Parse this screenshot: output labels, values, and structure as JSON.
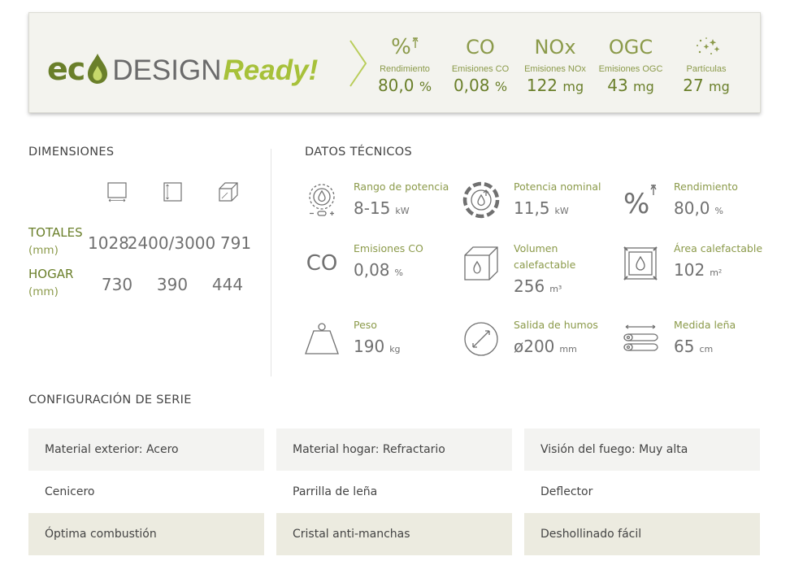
{
  "banner": {
    "logo": {
      "eco": "ec",
      "design": "DESIGN",
      "ready": "Ready!"
    },
    "metrics": [
      {
        "symbol": "%",
        "label": "Rendimiento",
        "value": "80,0",
        "unit": "%"
      },
      {
        "symbol": "CO",
        "label": "Emisiones CO",
        "value": "0,08",
        "unit": "%"
      },
      {
        "symbol": "NOx",
        "label": "Emisiones NOx",
        "value": "122",
        "unit": "mg"
      },
      {
        "symbol": "OGC",
        "label": "Emisiones OGC",
        "value": "43",
        "unit": "mg"
      },
      {
        "symbol": "",
        "label": "Partículas",
        "value": "27",
        "unit": "mg"
      }
    ],
    "colors": {
      "accent": "#a7c13a",
      "dark_green": "#6a7f2a",
      "olive": "#8b9a4a"
    }
  },
  "dimensions": {
    "title": "DIMENSIONES",
    "rows": [
      {
        "label": "TOTALES",
        "unit": "(mm)",
        "values": [
          "1028",
          "2400/3000",
          "791"
        ]
      },
      {
        "label": "HOGAR",
        "unit": "(mm)",
        "values": [
          "730",
          "390",
          "444"
        ]
      }
    ]
  },
  "tech": {
    "title": "DATOS TÉCNICOS",
    "items": [
      {
        "icon": "power-range-icon",
        "label": "Rango de potencia",
        "value": "8-15",
        "unit": "kW"
      },
      {
        "icon": "nominal-power-icon",
        "label": "Potencia nominal",
        "value": "11,5",
        "unit": "kW"
      },
      {
        "icon": "efficiency-icon",
        "label": "Rendimiento",
        "value": "80,0",
        "unit": "%"
      },
      {
        "icon": "co-emissions-icon",
        "icon_text": "CO",
        "label": "Emisiones CO",
        "value": "0,08",
        "unit": "%"
      },
      {
        "icon": "heated-volume-icon",
        "label": "Volumen calefactable",
        "label_line1": "Volumen",
        "label_line2": "calefactable",
        "value": "256",
        "unit": "m³"
      },
      {
        "icon": "heated-area-icon",
        "label": "Área calefactable",
        "value": "102",
        "unit": "m²"
      },
      {
        "icon": "weight-icon",
        "label": "Peso",
        "value": "190",
        "unit": "kg"
      },
      {
        "icon": "flue-outlet-icon",
        "label": "Salida de humos",
        "value": "ø200",
        "unit": "mm"
      },
      {
        "icon": "log-length-icon",
        "label": "Medida leña",
        "value": "65",
        "unit": "cm"
      }
    ]
  },
  "config": {
    "title": "CONFIGURACIÓN DE SERIE",
    "rows": [
      [
        "Material exterior: Acero",
        "Material hogar: Refractario",
        "Visión del fuego: Muy alta"
      ],
      [
        "Cenicero",
        "Parrilla de leña",
        "Deflector"
      ],
      [
        "Óptima combustión",
        "Cristal anti-manchas",
        "Deshollinado fácil"
      ]
    ]
  }
}
